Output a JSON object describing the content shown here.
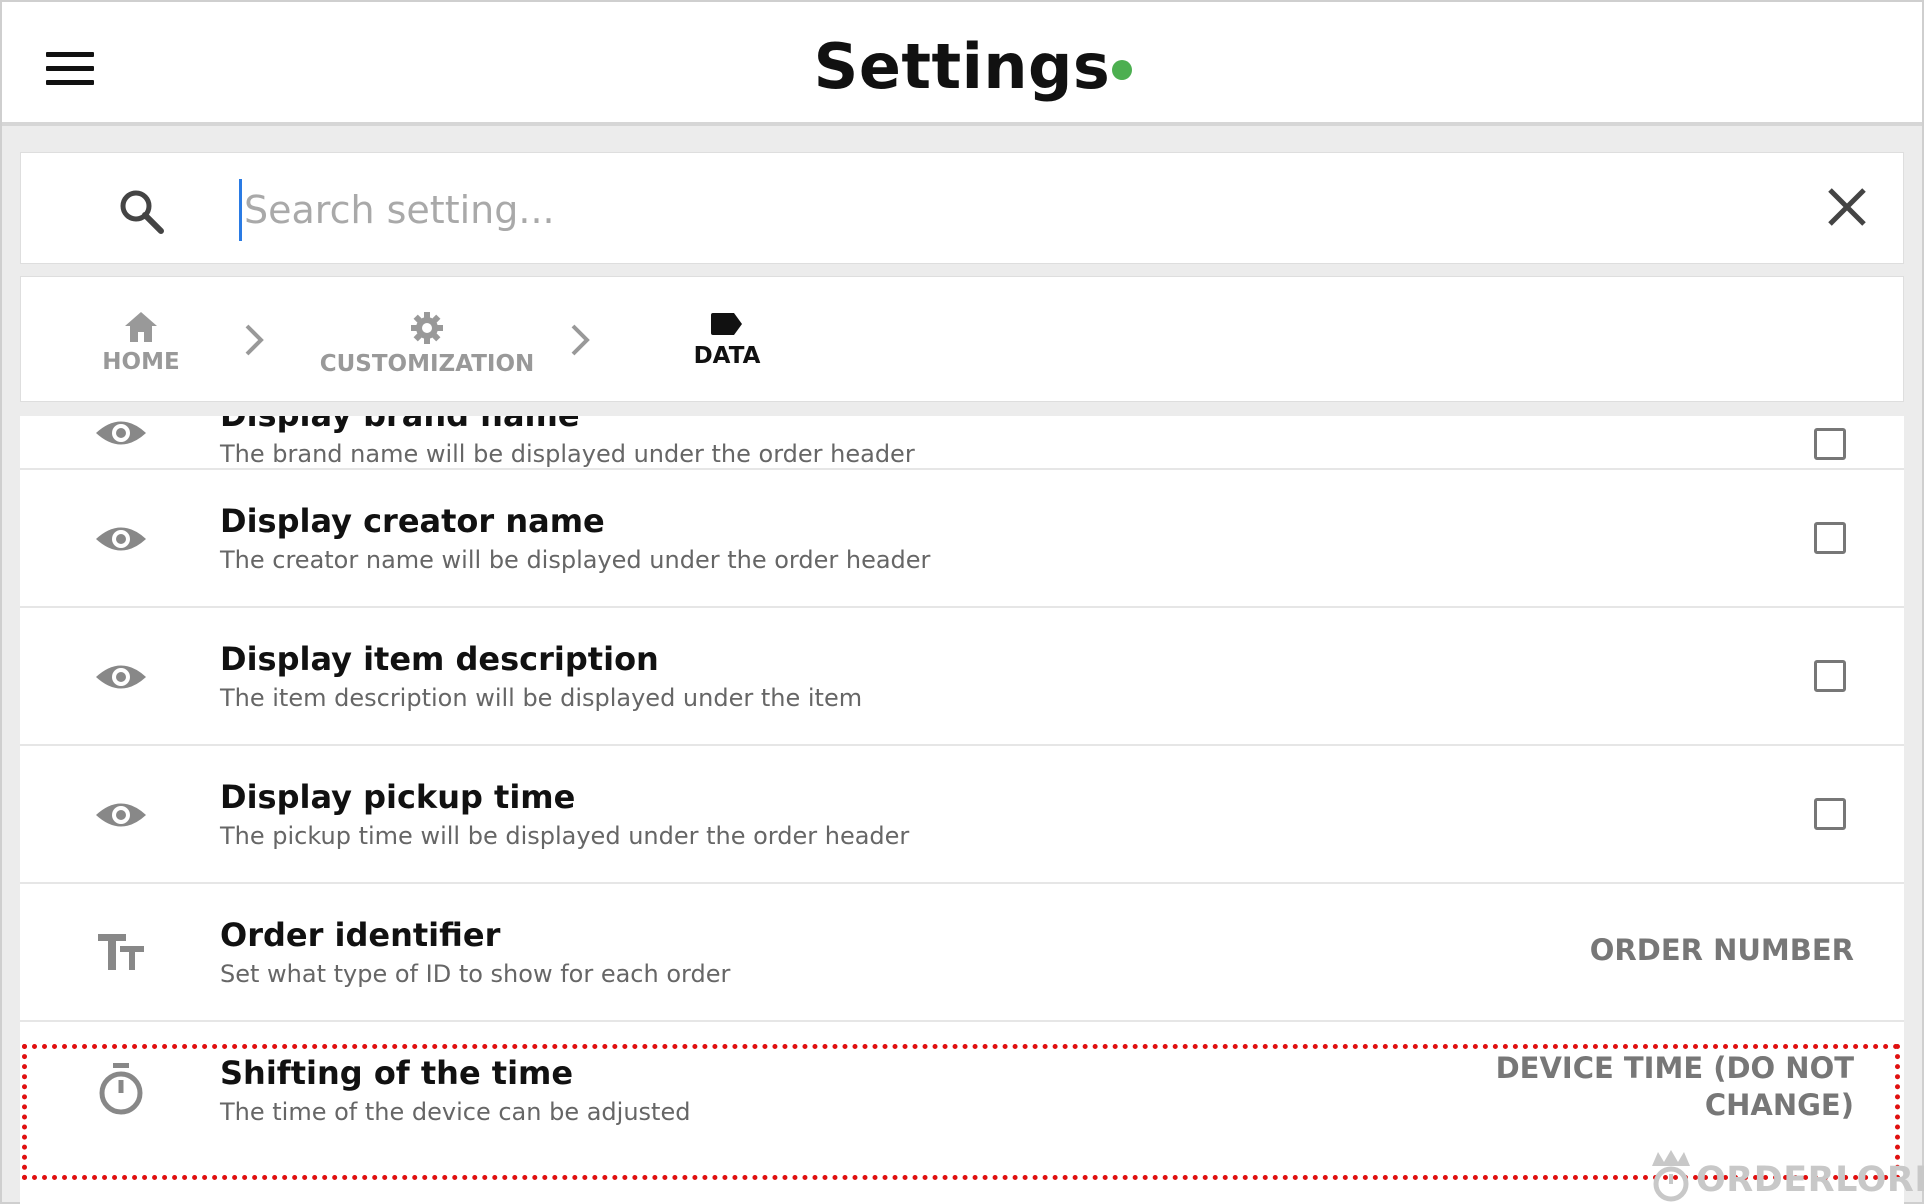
{
  "header": {
    "title": "Settings",
    "status_color": "#4caf50"
  },
  "search": {
    "placeholder": "Search setting..."
  },
  "breadcrumb": {
    "items": [
      {
        "label": "HOME",
        "icon": "home-icon"
      },
      {
        "label": "CUSTOMIZATION",
        "icon": "gear-icon"
      },
      {
        "label": "DATA",
        "icon": "label-tag-icon"
      }
    ]
  },
  "settings": [
    {
      "title": "Display brand name",
      "desc": "The brand name will be displayed under the order header",
      "icon": "eye-icon",
      "control": "checkbox",
      "checked": false
    },
    {
      "title": "Display creator name",
      "desc": "The creator name will be displayed under the order header",
      "icon": "eye-icon",
      "control": "checkbox",
      "checked": false
    },
    {
      "title": "Display item description",
      "desc": "The item description will be displayed under the item",
      "icon": "eye-icon",
      "control": "checkbox",
      "checked": false
    },
    {
      "title": "Display pickup time",
      "desc": "The pickup time will be displayed under the order header",
      "icon": "eye-icon",
      "control": "checkbox",
      "checked": false
    },
    {
      "title": "Order identifier",
      "desc": "Set what type of ID to show for each order",
      "icon": "text-size-icon",
      "control": "value",
      "value": "ORDER NUMBER"
    },
    {
      "title": "Shifting of the time",
      "desc": "The time of the device can be adjusted",
      "icon": "timer-icon",
      "control": "value",
      "value_line1": "DEVICE TIME (DO NOT",
      "value_line2": "CHANGE)"
    }
  ],
  "brand": {
    "logo_text": "ORDERLORD"
  },
  "colors": {
    "accent": "#2a7be4",
    "highlight": "#e01010"
  }
}
